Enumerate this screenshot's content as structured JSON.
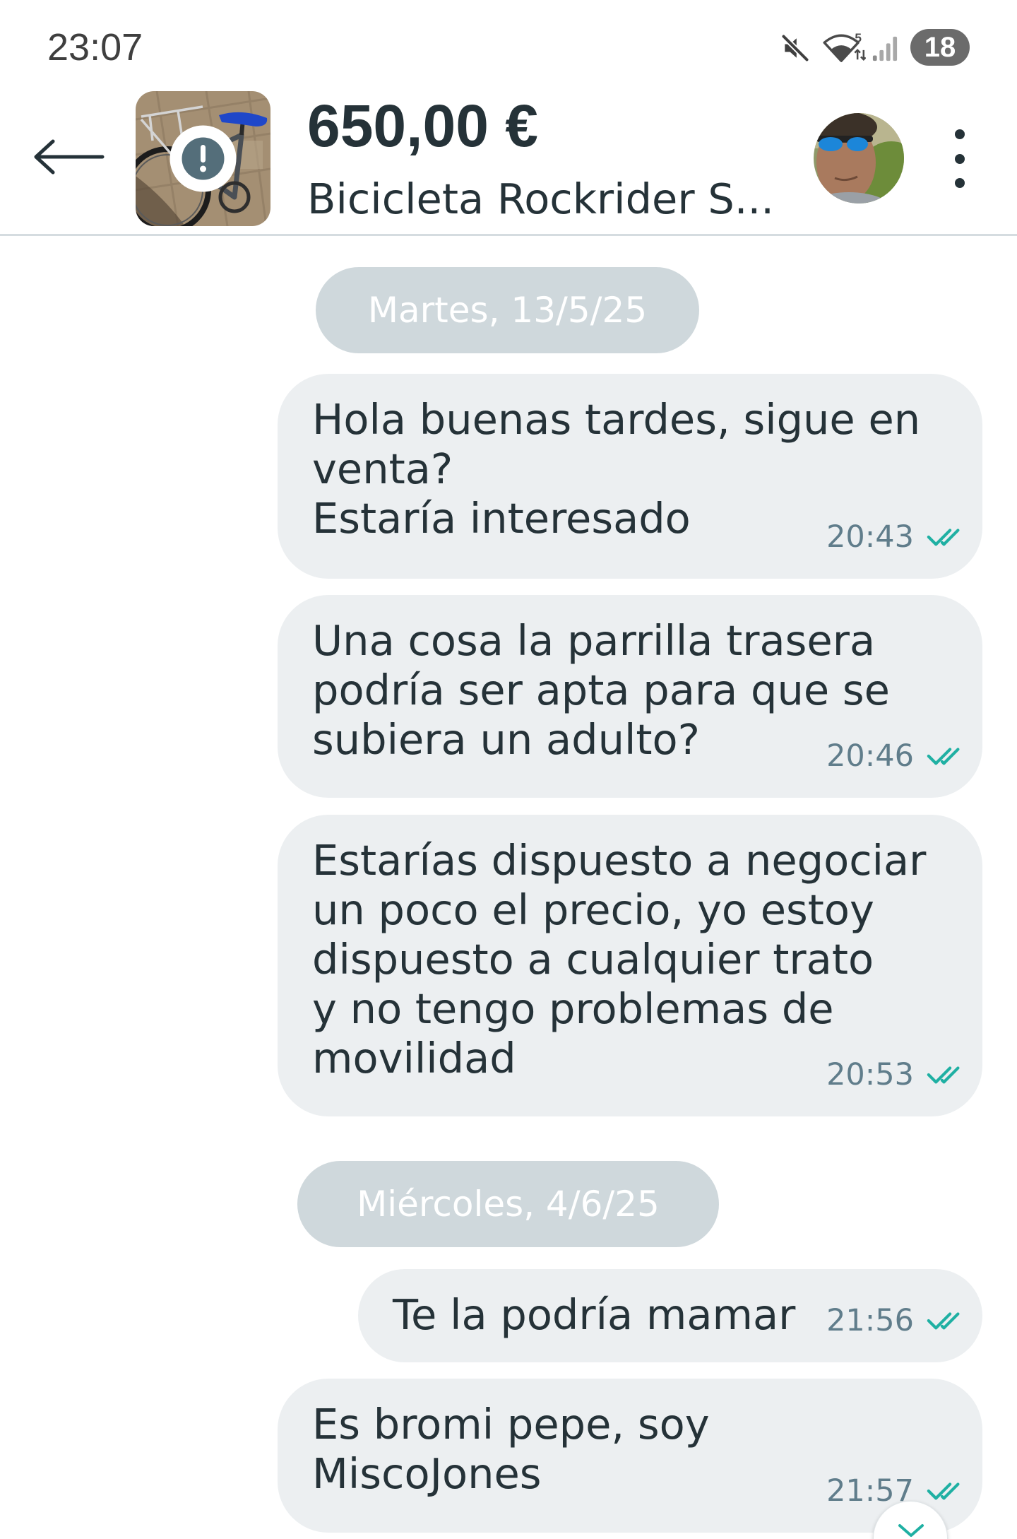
{
  "status_bar": {
    "time": "23:07",
    "wifi_band": "5",
    "battery_level": "18",
    "icons": {
      "sound": "mute-icon",
      "wifi": "wifi-icon",
      "signal": "signal-icon",
      "battery": "battery-icon"
    }
  },
  "header": {
    "price": "650,00 €",
    "title": "Bicicleta Rockrider S...",
    "icons": {
      "back": "arrow-left-icon",
      "item_alert": "alert-circle-icon",
      "menu": "more-vertical-icon"
    }
  },
  "conversation": {
    "days": [
      {
        "date_label": "Martes, 13/5/25",
        "messages": [
          {
            "lines": [
              "Hola buenas tardes, sigue en",
              "venta?",
              "Estaría interesado"
            ],
            "time": "20:43",
            "status_icon": "double-check-icon"
          },
          {
            "lines": [
              "Una cosa la parrilla trasera",
              "podría ser apta para que se",
              "subiera un adulto?"
            ],
            "time": "20:46",
            "status_icon": "double-check-icon"
          },
          {
            "lines": [
              "Estarías dispuesto a negociar",
              "un poco el precio, yo estoy",
              "dispuesto a cualquier trato",
              "y no tengo problemas de",
              "movilidad"
            ],
            "time": "20:53",
            "status_icon": "double-check-icon"
          }
        ]
      },
      {
        "date_label": "Miércoles, 4/6/25",
        "messages": [
          {
            "lines": [
              "Te la podría mamar"
            ],
            "time": "21:56",
            "status_icon": "double-check-icon"
          },
          {
            "lines": [
              "Es bromi pepe, soy",
              "MiscoJones"
            ],
            "time": "21:57",
            "status_icon": "double-check-icon"
          }
        ]
      }
    ]
  },
  "scroll_button": {
    "icon": "chevron-down-icon"
  },
  "colors": {
    "bubble": "#ECEFF1",
    "pill": "#CFD8DC",
    "text": "#253238",
    "time": "#607D8B",
    "check": "#1FB0A3",
    "divider": "#D5DCE0",
    "status": "#3F3F3F"
  }
}
